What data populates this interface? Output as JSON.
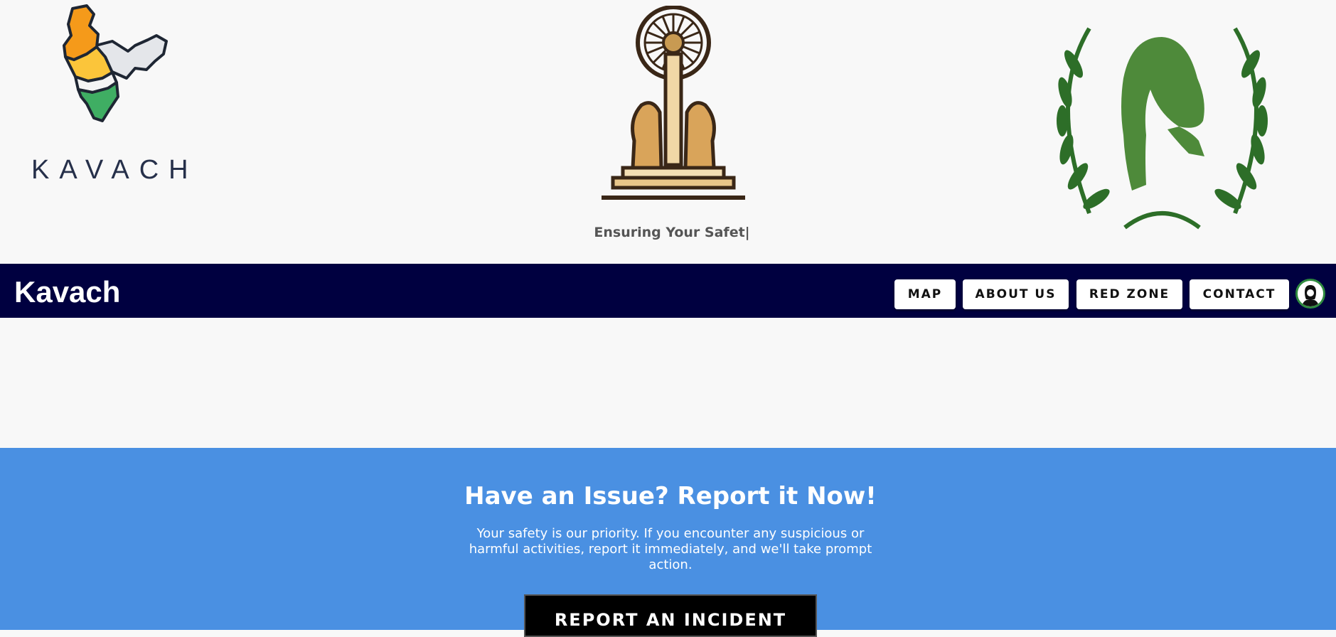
{
  "hero": {
    "left_logo_name": "india-map-logo",
    "brand_wordmark": "KAVACH",
    "center_emblem_name": "ashoka-pillar-emblem",
    "tagline": "Ensuring Your Safet|",
    "right_logo_name": "woman-laurel-wreath-logo"
  },
  "navbar": {
    "title": "Kavach",
    "links": [
      {
        "label": "MAP"
      },
      {
        "label": "ABOUT US"
      },
      {
        "label": "RED ZONE"
      },
      {
        "label": "CONTACT"
      }
    ],
    "avatar_icon": "user-avatar-icon",
    "background": "#000040"
  },
  "report": {
    "title": "Have an Issue? Report it Now!",
    "description": "Your safety is our priority. If you encounter any suspicious or harmful activities, report it immediately, and we'll take prompt action.",
    "button_label": "REPORT AN INCIDENT",
    "background": "#4a90e2"
  }
}
